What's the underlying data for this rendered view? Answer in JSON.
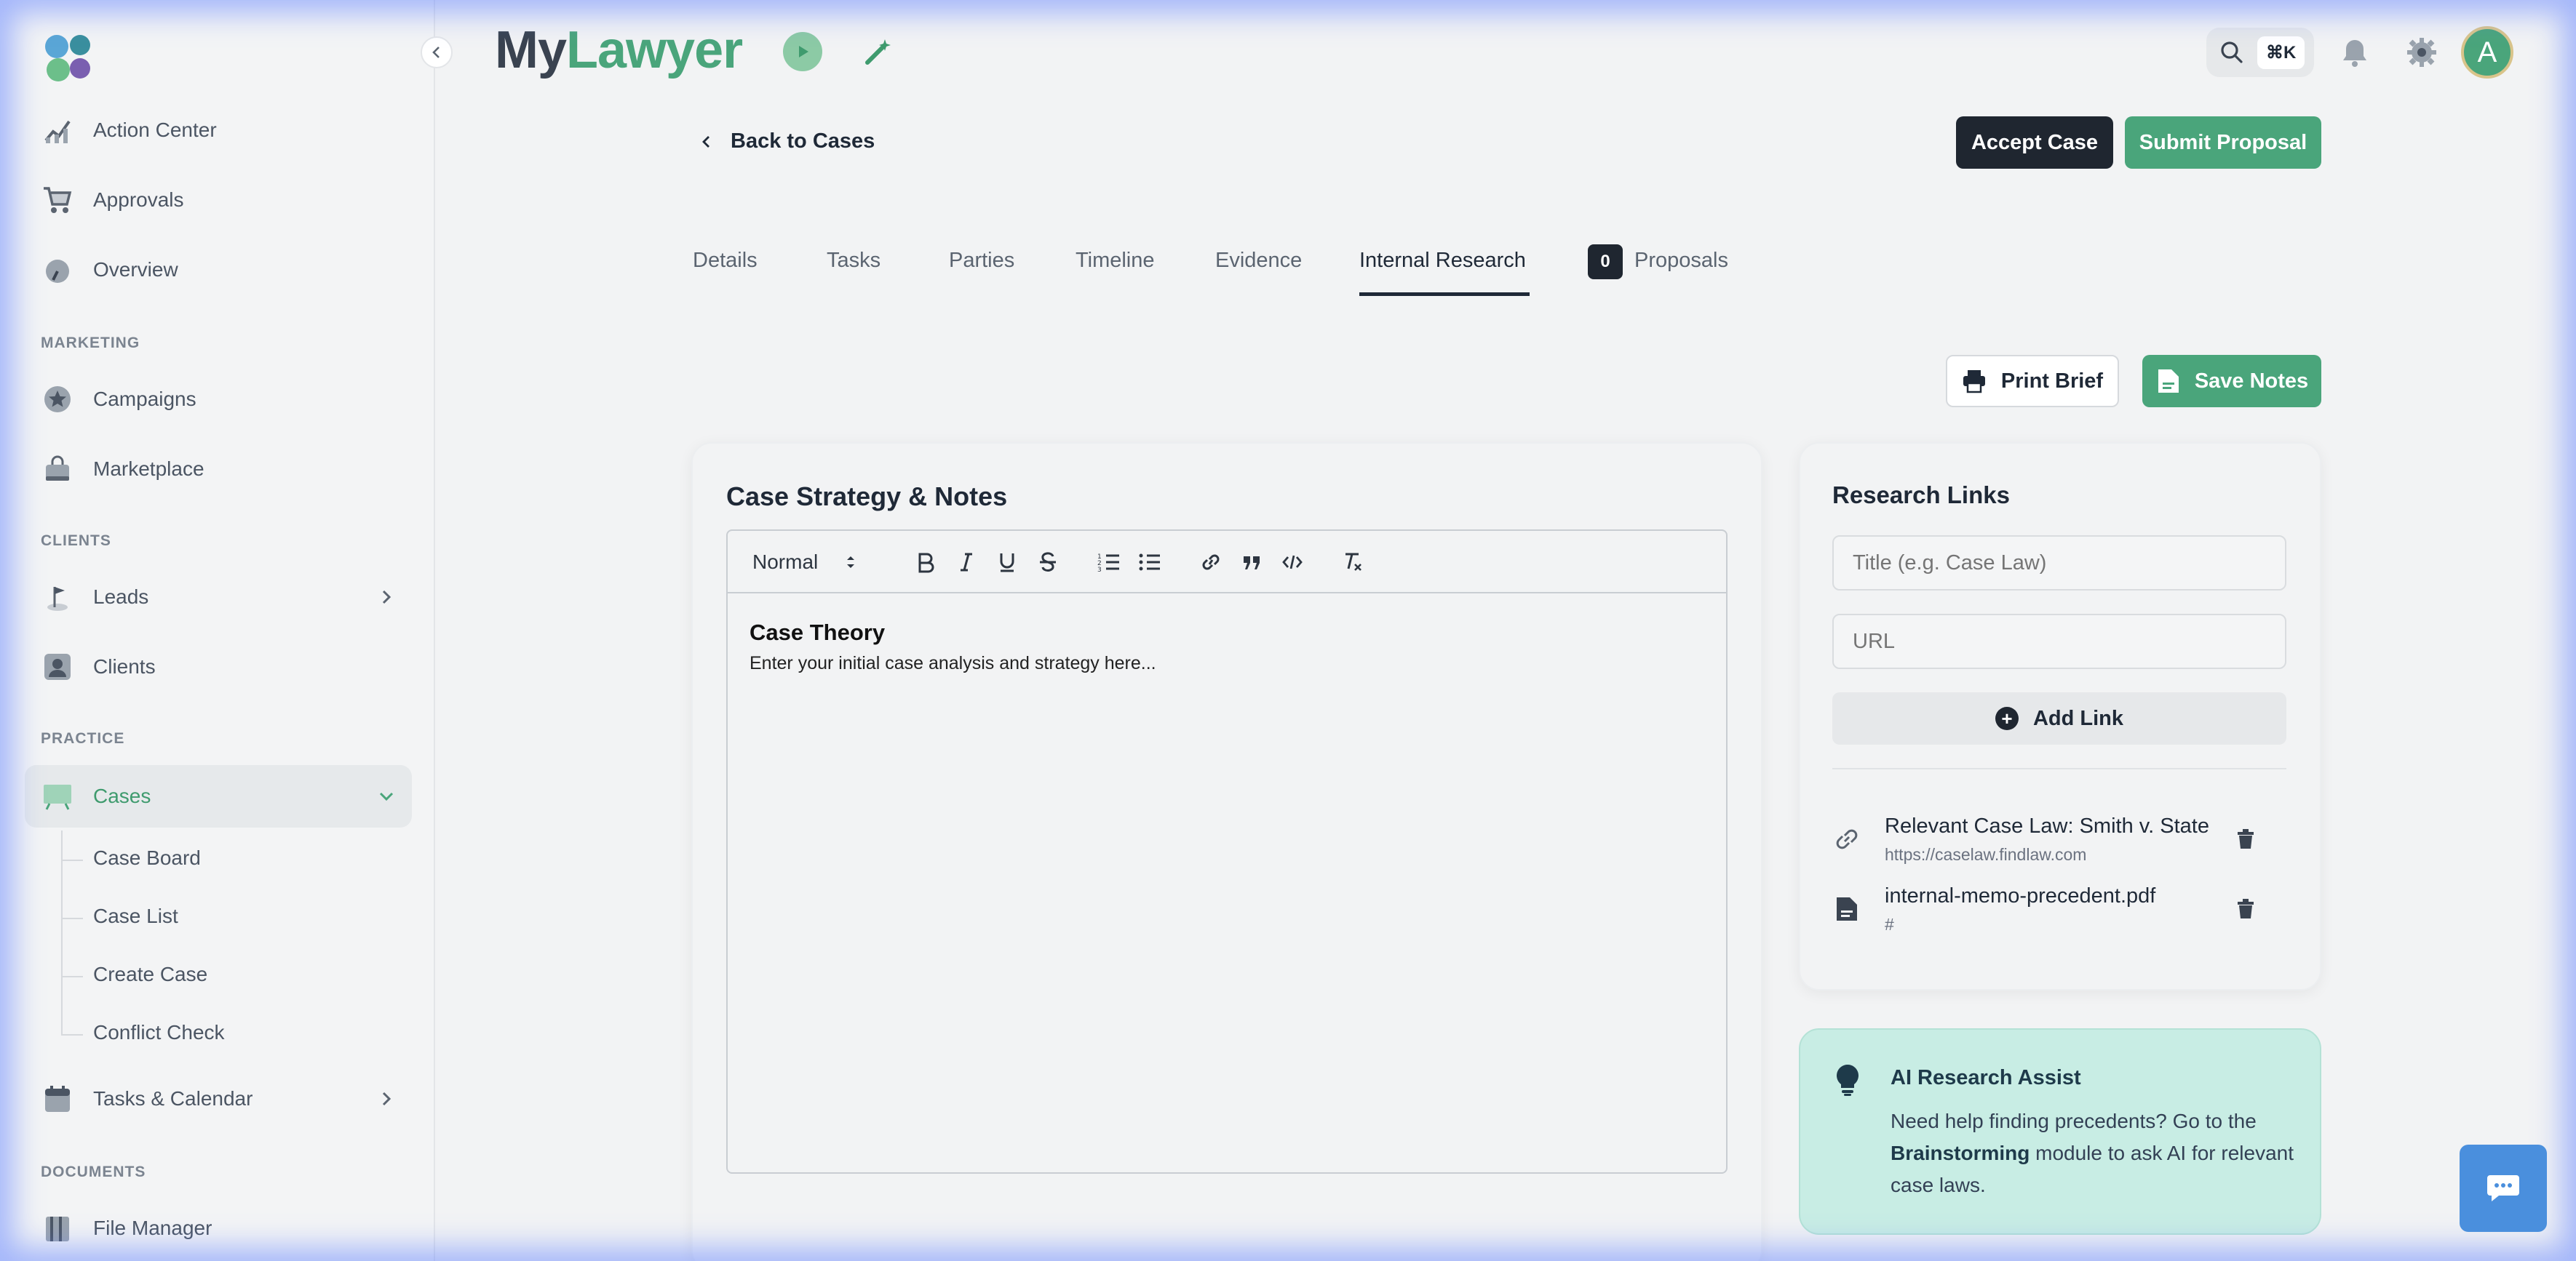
{
  "app": {
    "brand_my": "My",
    "brand_lawyer": "Lawyer"
  },
  "sidebar": {
    "items": [
      {
        "label": "Action Center"
      },
      {
        "label": "Approvals"
      },
      {
        "label": "Overview"
      },
      {
        "label": "Campaigns"
      },
      {
        "label": "Marketplace"
      },
      {
        "label": "Leads"
      },
      {
        "label": "Clients"
      },
      {
        "label": "Cases"
      },
      {
        "label": "Tasks & Calendar"
      },
      {
        "label": "File Manager"
      }
    ],
    "sections": {
      "marketing": "MARKETING",
      "clients": "CLIENTS",
      "practice": "PRACTICE",
      "documents": "DOCUMENTS"
    },
    "cases_sub": [
      "Case Board",
      "Case List",
      "Create Case",
      "Conflict Check"
    ]
  },
  "header": {
    "search_shortcut": "⌘K",
    "avatar_initial": "A"
  },
  "page": {
    "back_label": "Back to Cases",
    "accept_label": "Accept Case",
    "submit_label": "Submit Proposal",
    "tabs": [
      "Details",
      "Tasks",
      "Parties",
      "Timeline",
      "Evidence",
      "Internal Research",
      "Proposals"
    ],
    "active_tab": "Internal Research",
    "proposals_count": "0",
    "print_label": "Print Brief",
    "save_label": "Save Notes"
  },
  "notes": {
    "title": "Case Strategy & Notes",
    "format_select": "Normal",
    "heading": "Case Theory",
    "body": "Enter your initial case analysis and strategy here..."
  },
  "research": {
    "title": "Research Links",
    "title_placeholder": "Title (e.g. Case Law)",
    "url_placeholder": "URL",
    "add_label": "Add Link",
    "links": [
      {
        "title": "Relevant Case Law: Smith v. State",
        "url": "https://caselaw.findlaw.com",
        "icon": "link-icon"
      },
      {
        "title": "internal-memo-precedent.pdf",
        "url": "#",
        "icon": "file-icon"
      }
    ]
  },
  "ai": {
    "title": "AI Research Assist",
    "text_before": "Need help finding precedents? Go to the ",
    "text_bold": "Brainstorming",
    "text_after": " module to ask AI for relevant case laws."
  },
  "colors": {
    "accent": "#4aa57b",
    "dark": "#1f2630",
    "ai_bg": "#c8ede4"
  }
}
